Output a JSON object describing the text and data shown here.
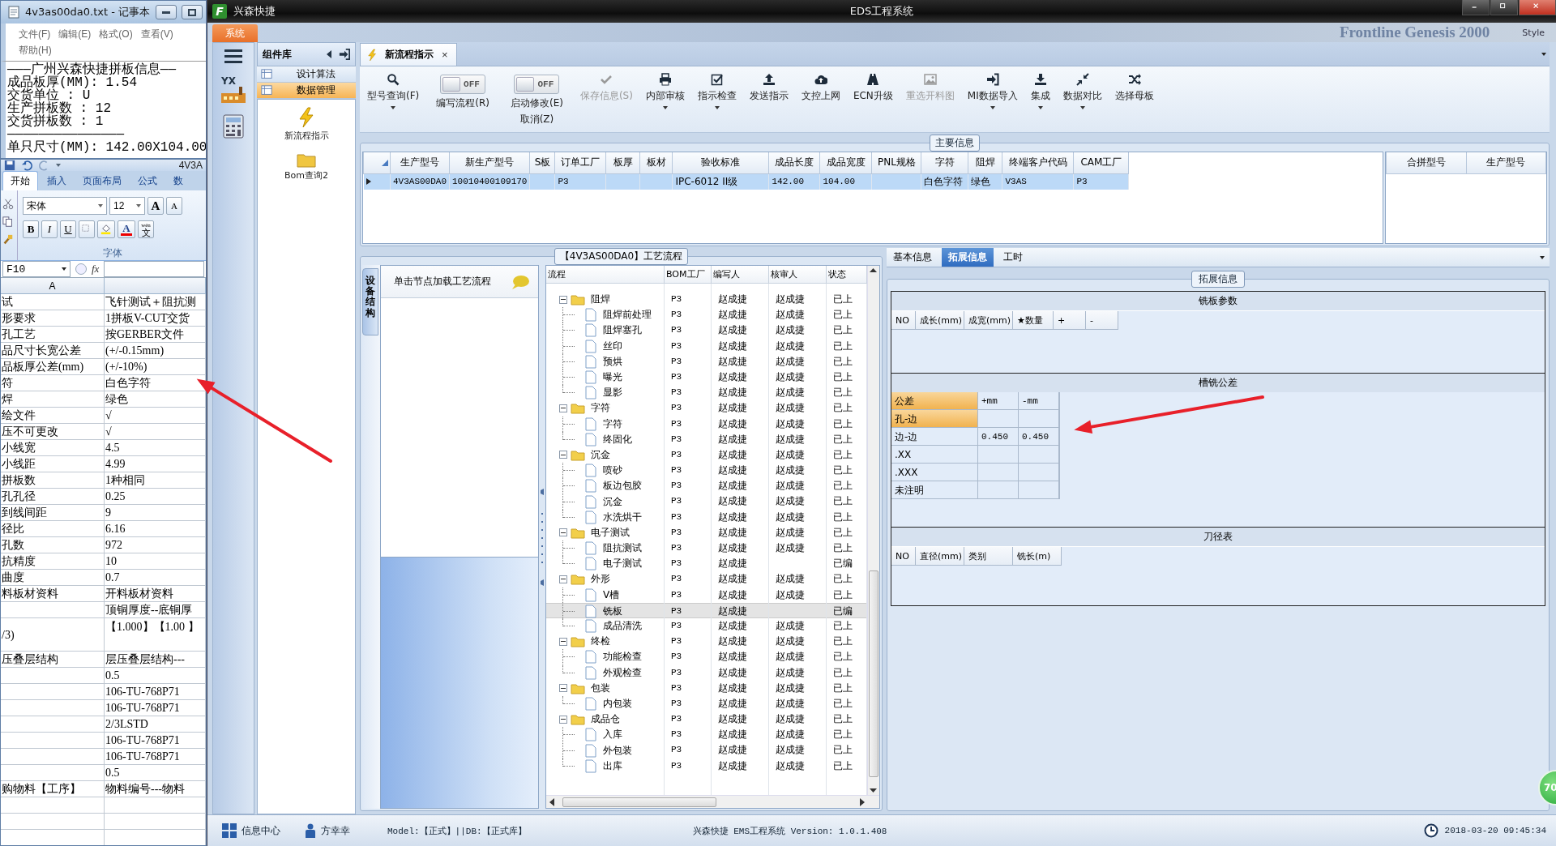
{
  "notepad": {
    "title": "4v3as00da0.txt - 记事本",
    "menu": [
      "文件(F)",
      "编辑(E)",
      "格式(O)",
      "查看(V)",
      "帮助(H)"
    ],
    "lines": [
      "———广州兴森快捷拼板信息——",
      "成品板厚(MM): 1.54",
      "交货单位 : U",
      "生产拼板数 : 12",
      "交货拼板数 : 1",
      "———————————————",
      "单只尺寸(MM): 142.00X104.00"
    ]
  },
  "excel": {
    "title": "4V3A",
    "tabs": [
      {
        "label": "开始",
        "selected": true
      },
      {
        "label": "插入",
        "selected": false
      },
      {
        "label": "页面布局",
        "selected": false
      },
      {
        "label": "公式",
        "selected": false
      },
      {
        "label": "数",
        "selected": false
      }
    ],
    "font_name": "宋体",
    "font_size": "12",
    "grow_button": "A",
    "shrink_button": "A",
    "format_buttons": [
      "B",
      "I",
      "U"
    ],
    "font_color_button": "A",
    "phonetic_button": {
      "ruby": "wén",
      "text": "文"
    },
    "group_label": "字体",
    "name_box": "F10",
    "fx": "fx",
    "column_header": "A",
    "rows": [
      [
        "试",
        "飞针测试＋阻抗测"
      ],
      [
        "形要求",
        "1拼板V-CUT交货"
      ],
      [
        "孔工艺",
        "按GERBER文件"
      ],
      [
        "品尺寸长宽公差",
        "(+/-0.15mm)"
      ],
      [
        "品板厚公差(mm)",
        "(+/-10%)"
      ],
      [
        "符",
        "白色字符"
      ],
      [
        "焊",
        "绿色"
      ],
      [
        "绘文件",
        "√"
      ],
      [
        "压不可更改",
        "√"
      ],
      [
        "小线宽",
        "4.5"
      ],
      [
        "小线距",
        "4.99"
      ],
      [
        "拼板数",
        "1种相同"
      ],
      [
        "孔孔径",
        "0.25"
      ],
      [
        "到线间距",
        "9"
      ],
      [
        "径比",
        "6.16"
      ],
      [
        "孔数",
        "972"
      ],
      [
        "抗精度",
        "10"
      ],
      [
        "曲度",
        "0.7"
      ],
      [
        "料板材资料",
        "开料板材资料"
      ],
      [
        null,
        "顶铜厚度--底铜厚"
      ],
      [
        "/3)",
        "【1.000】【1.00 】"
      ],
      [
        "压叠层结构",
        "层压叠层结构---"
      ],
      [
        null,
        "0.5"
      ],
      [
        null,
        "106-TU-768P71"
      ],
      [
        null,
        "106-TU-768P71"
      ],
      [
        null,
        "2/3LSTD"
      ],
      [
        null,
        "106-TU-768P71"
      ],
      [
        null,
        "106-TU-768P71"
      ],
      [
        null,
        "0.5"
      ],
      [
        "购物料【工序】",
        "物料编号---物料"
      ]
    ]
  },
  "app": {
    "logo": "F",
    "name": "兴森快捷",
    "title": "EDS工程系统",
    "ghost_texts": [
      "Frontline Genesis 2000",
      "Style"
    ]
  },
  "system_tab": "系统",
  "strip": {
    "logo_text": "YX"
  },
  "component_panel": {
    "title": "组件库",
    "items": [
      {
        "label": "设计算法",
        "selected": false
      },
      {
        "label": "数据管理",
        "selected": true
      }
    ],
    "tools": [
      "新流程指示",
      "Bom查询2"
    ]
  },
  "doc_tab": {
    "label": "新流程指示",
    "close": "×"
  },
  "toolbar": [
    {
      "kind": "button",
      "label": "型号查询(F)",
      "dropdown": true,
      "disabled": false
    },
    {
      "kind": "toggle",
      "label": "编写流程(R)",
      "switch": "OFF",
      "on": false
    },
    {
      "kind": "toggle",
      "label": "启动修改(E)",
      "sublabel": "取消(Z)",
      "switch": "OFF",
      "on": false
    },
    {
      "kind": "button",
      "label": "保存信息(S)",
      "dropdown": false,
      "disabled": true
    },
    {
      "kind": "button",
      "label": "内部审核",
      "dropdown": true,
      "disabled": false
    },
    {
      "kind": "button",
      "label": "指示检查",
      "dropdown": true,
      "disabled": false
    },
    {
      "kind": "button",
      "label": "发送指示",
      "dropdown": false,
      "disabled": false
    },
    {
      "kind": "button",
      "label": "文控上网",
      "dropdown": false,
      "disabled": false
    },
    {
      "kind": "button",
      "label": "ECN升级",
      "dropdown": false,
      "disabled": false
    },
    {
      "kind": "button",
      "label": "重选开料图",
      "dropdown": false,
      "disabled": true
    },
    {
      "kind": "button",
      "label": "MI数据导入",
      "dropdown": true,
      "disabled": false
    },
    {
      "kind": "button",
      "label": "集成",
      "dropdown": true,
      "disabled": false
    },
    {
      "kind": "button",
      "label": "数据对比",
      "dropdown": true,
      "disabled": false
    },
    {
      "kind": "button",
      "label": "选择母板",
      "dropdown": false,
      "disabled": false
    }
  ],
  "main_info": {
    "legend": "主要信息",
    "columns": [
      "生产型号",
      "新生产型号",
      "S板",
      "订单工厂",
      "板厚",
      "板材",
      "验收标准",
      "成品长度",
      "成品宽度",
      "PNL规格",
      "字符",
      "阻焊",
      "终端客户代码",
      "CAM工厂"
    ],
    "rows": [
      {
        "selected": true,
        "cells": [
          "4V3AS00DA0",
          "10010400109170",
          null,
          "P3",
          null,
          null,
          "IPC-6012 II级",
          "142.00",
          "104.00",
          null,
          "白色字符",
          "绿色",
          "V3AS",
          "P3"
        ]
      }
    ],
    "side_columns": [
      "合拼型号",
      "生产型号"
    ]
  },
  "flow": {
    "legend": "【4V3AS00DA0】工艺流程",
    "side_tab": "设备结构",
    "hint": "单击节点加载工艺流程",
    "columns": [
      "流程",
      "BOM工厂",
      "编写人",
      "核审人",
      "状态"
    ],
    "tree": [
      {
        "name": "阻焊",
        "factory": "P3",
        "writer": "赵成捷",
        "reviewer": "赵成捷",
        "status": "已上",
        "expanded": true,
        "selected": false,
        "children": [
          {
            "name": "阻焊前处理",
            "factory": "P3",
            "writer": "赵成捷",
            "reviewer": "赵成捷",
            "status": "已上",
            "selected": false
          },
          {
            "name": "阻焊塞孔",
            "factory": "P3",
            "writer": "赵成捷",
            "reviewer": "赵成捷",
            "status": "已上",
            "selected": false
          },
          {
            "name": "丝印",
            "factory": "P3",
            "writer": "赵成捷",
            "reviewer": "赵成捷",
            "status": "已上",
            "selected": false
          },
          {
            "name": "预烘",
            "factory": "P3",
            "writer": "赵成捷",
            "reviewer": "赵成捷",
            "status": "已上",
            "selected": false
          },
          {
            "name": "曝光",
            "factory": "P3",
            "writer": "赵成捷",
            "reviewer": "赵成捷",
            "status": "已上",
            "selected": false
          },
          {
            "name": "显影",
            "factory": "P3",
            "writer": "赵成捷",
            "reviewer": "赵成捷",
            "status": "已上",
            "selected": false
          }
        ]
      },
      {
        "name": "字符",
        "factory": "P3",
        "writer": "赵成捷",
        "reviewer": "赵成捷",
        "status": "已上",
        "expanded": true,
        "selected": false,
        "children": [
          {
            "name": "字符",
            "factory": "P3",
            "writer": "赵成捷",
            "reviewer": "赵成捷",
            "status": "已上",
            "selected": false
          },
          {
            "name": "终固化",
            "factory": "P3",
            "writer": "赵成捷",
            "reviewer": "赵成捷",
            "status": "已上",
            "selected": false
          }
        ]
      },
      {
        "name": "沉金",
        "factory": "P3",
        "writer": "赵成捷",
        "reviewer": "赵成捷",
        "status": "已上",
        "expanded": true,
        "selected": false,
        "children": [
          {
            "name": "喷砂",
            "factory": "P3",
            "writer": "赵成捷",
            "reviewer": "赵成捷",
            "status": "已上",
            "selected": false
          },
          {
            "name": "板边包胶",
            "factory": "P3",
            "writer": "赵成捷",
            "reviewer": "赵成捷",
            "status": "已上",
            "selected": false
          },
          {
            "name": "沉金",
            "factory": "P3",
            "writer": "赵成捷",
            "reviewer": "赵成捷",
            "status": "已上",
            "selected": false
          },
          {
            "name": "水洗烘干",
            "factory": "P3",
            "writer": "赵成捷",
            "reviewer": "赵成捷",
            "status": "已上",
            "selected": false
          }
        ]
      },
      {
        "name": "电子测试",
        "factory": "P3",
        "writer": "赵成捷",
        "reviewer": "赵成捷",
        "status": "已上",
        "expanded": true,
        "selected": false,
        "children": [
          {
            "name": "阻抗测试",
            "factory": "P3",
            "writer": "赵成捷",
            "reviewer": "赵成捷",
            "status": "已上",
            "selected": false
          },
          {
            "name": "电子测试",
            "factory": "P3",
            "writer": "赵成捷",
            "status": "已编",
            "selected": false
          }
        ]
      },
      {
        "name": "外形",
        "factory": "P3",
        "writer": "赵成捷",
        "reviewer": "赵成捷",
        "status": "已上",
        "expanded": true,
        "selected": false,
        "children": [
          {
            "name": "V槽",
            "factory": "P3",
            "writer": "赵成捷",
            "reviewer": "赵成捷",
            "status": "已上",
            "selected": false
          },
          {
            "name": "铣板",
            "factory": "P3",
            "writer": "赵成捷",
            "status": "已编",
            "selected": true
          },
          {
            "name": "成品清洗",
            "factory": "P3",
            "writer": "赵成捷",
            "reviewer": "赵成捷",
            "status": "已上",
            "selected": false
          }
        ]
      },
      {
        "name": "终检",
        "factory": "P3",
        "writer": "赵成捷",
        "reviewer": "赵成捷",
        "status": "已上",
        "expanded": true,
        "selected": false,
        "children": [
          {
            "name": "功能检查",
            "factory": "P3",
            "writer": "赵成捷",
            "reviewer": "赵成捷",
            "status": "已上",
            "selected": false
          },
          {
            "name": "外观检查",
            "factory": "P3",
            "writer": "赵成捷",
            "reviewer": "赵成捷",
            "status": "已上",
            "selected": false
          }
        ]
      },
      {
        "name": "包装",
        "factory": "P3",
        "writer": "赵成捷",
        "reviewer": "赵成捷",
        "status": "已上",
        "expanded": true,
        "selected": false,
        "children": [
          {
            "name": "内包装",
            "factory": "P3",
            "writer": "赵成捷",
            "reviewer": "赵成捷",
            "status": "已上",
            "selected": false
          }
        ]
      },
      {
        "name": "成品仓",
        "factory": "P3",
        "writer": "赵成捷",
        "reviewer": "赵成捷",
        "status": "已上",
        "expanded": true,
        "selected": false,
        "children": [
          {
            "name": "入库",
            "factory": "P3",
            "writer": "赵成捷",
            "reviewer": "赵成捷",
            "status": "已上",
            "selected": false
          },
          {
            "name": "外包装",
            "factory": "P3",
            "writer": "赵成捷",
            "reviewer": "赵成捷",
            "status": "已上",
            "selected": false
          },
          {
            "name": "出库",
            "factory": "P3",
            "writer": "赵成捷",
            "reviewer": "赵成捷",
            "status": "已上",
            "selected": false
          }
        ]
      }
    ]
  },
  "ext": {
    "tabs": [
      {
        "label": "基本信息",
        "selected": false
      },
      {
        "label": "拓展信息",
        "selected": true
      },
      {
        "label": "工时",
        "selected": false
      }
    ],
    "legend": "拓展信息",
    "sections": [
      {
        "kind": "grid",
        "title": "铣板参数",
        "columns": [
          "NO",
          "成长(mm)",
          "成宽(mm)",
          "★数量",
          "+",
          "-"
        ]
      },
      {
        "kind": "tolerance",
        "title": "槽铣公差",
        "header": [
          "公差",
          "+mm",
          "-mm"
        ],
        "rows": [
          {
            "label": "孔-边",
            "selected": true
          },
          {
            "label": "边-边",
            "plus": "0.450",
            "minus": "0.450",
            "selected": false
          },
          {
            "label": ".XX",
            "selected": false
          },
          {
            "label": ".XXX",
            "selected": false
          },
          {
            "label": "未注明",
            "selected": false
          }
        ]
      },
      {
        "kind": "grid",
        "title": "刀径表",
        "columns": [
          "NO",
          "直径(mm)",
          "类别",
          "铣长(m)"
        ]
      }
    ]
  },
  "status_bar": {
    "info_center": "信息中心",
    "user": "方幸幸",
    "model": "Model:【正式】||DB:【正式库】",
    "version": "兴森快捷 EMS工程系统 Version: 1.0.1.408",
    "datetime": "2018-03-20 09:45:34"
  },
  "badge": "70"
}
